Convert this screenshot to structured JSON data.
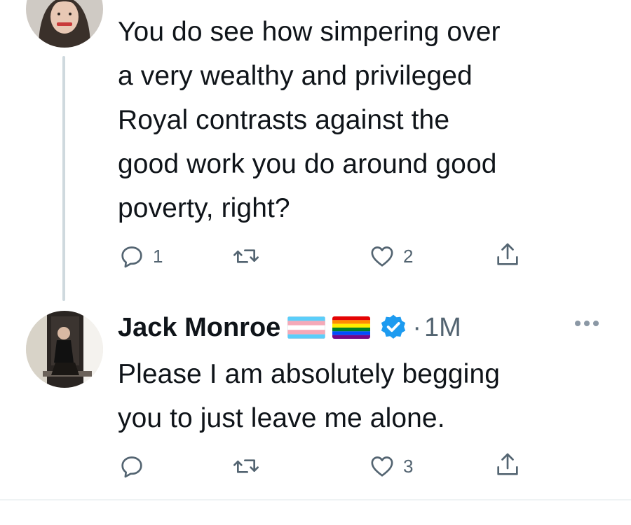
{
  "tweet1": {
    "lines": [
      "You do see how simpering over",
      "a very wealthy and privileged",
      "Royal contrasts against the",
      "good work you do around good",
      "poverty, right?"
    ],
    "reply_count": "1",
    "retweet_count": "",
    "like_count": "2"
  },
  "tweet2": {
    "author_name": "Jack Monroe",
    "time": "1M",
    "separator": "·",
    "lines": [
      "Please I am absolutely begging",
      "you to just leave me alone."
    ],
    "reply_count": "",
    "retweet_count": "",
    "like_count": "3"
  },
  "icons": {
    "reply": "reply-icon",
    "retweet": "retweet-icon",
    "like": "heart-icon",
    "share": "share-icon",
    "verified": "verified-badge-icon",
    "more": "more-icon"
  },
  "colors": {
    "text": "#0f1419",
    "secondary": "#536471",
    "verified_blue": "#1d9bf0",
    "thread_line": "#cfd9de"
  }
}
